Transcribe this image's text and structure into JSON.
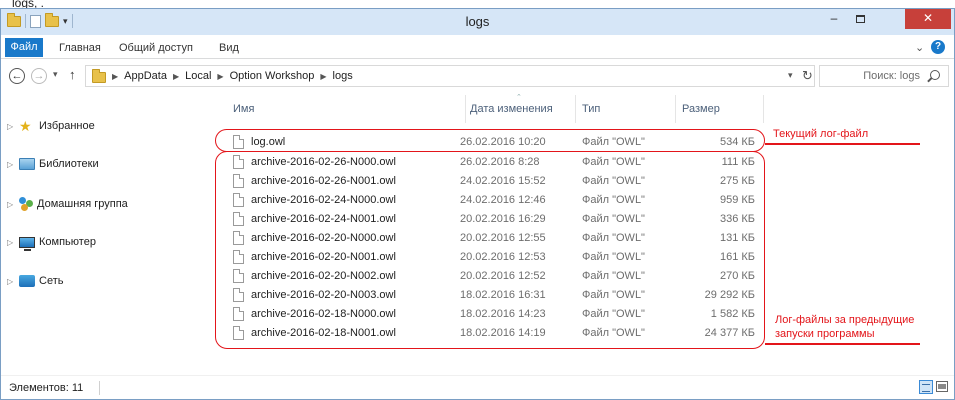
{
  "window": {
    "title": "logs",
    "top_caption": "logs, ."
  },
  "ribbon": {
    "tab_file": "Файл",
    "tab_home": "Главная",
    "tab_share": "Общий доступ",
    "tab_view": "Вид"
  },
  "address": {
    "crumbs": [
      "AppData",
      "Local",
      "Option Workshop",
      "logs"
    ],
    "search_placeholder": "Поиск: logs"
  },
  "nav": {
    "favorites": "Избранное",
    "libraries": "Библиотеки",
    "homegroup": "Домашняя группа",
    "computer": "Компьютер",
    "network": "Сеть"
  },
  "columns": {
    "name": "Имя",
    "date": "Дата изменения",
    "type": "Тип",
    "size": "Размер"
  },
  "files": [
    {
      "name": "log.owl",
      "date": "26.02.2016 10:20",
      "type": "Файл \"OWL\"",
      "size": "534 КБ"
    },
    {
      "name": "archive-2016-02-26-N000.owl",
      "date": "26.02.2016 8:28",
      "type": "Файл \"OWL\"",
      "size": "111 КБ"
    },
    {
      "name": "archive-2016-02-26-N001.owl",
      "date": "24.02.2016 15:52",
      "type": "Файл \"OWL\"",
      "size": "275 КБ"
    },
    {
      "name": "archive-2016-02-24-N000.owl",
      "date": "24.02.2016 12:46",
      "type": "Файл \"OWL\"",
      "size": "959 КБ"
    },
    {
      "name": "archive-2016-02-24-N001.owl",
      "date": "20.02.2016 16:29",
      "type": "Файл \"OWL\"",
      "size": "336 КБ"
    },
    {
      "name": "archive-2016-02-20-N000.owl",
      "date": "20.02.2016 12:55",
      "type": "Файл \"OWL\"",
      "size": "131 КБ"
    },
    {
      "name": "archive-2016-02-20-N001.owl",
      "date": "20.02.2016 12:53",
      "type": "Файл \"OWL\"",
      "size": "161 КБ"
    },
    {
      "name": "archive-2016-02-20-N002.owl",
      "date": "20.02.2016 12:52",
      "type": "Файл \"OWL\"",
      "size": "270 КБ"
    },
    {
      "name": "archive-2016-02-20-N003.owl",
      "date": "18.02.2016 16:31",
      "type": "Файл \"OWL\"",
      "size": "29 292 КБ"
    },
    {
      "name": "archive-2016-02-18-N000.owl",
      "date": "18.02.2016 14:23",
      "type": "Файл \"OWL\"",
      "size": "1 582 КБ"
    },
    {
      "name": "archive-2016-02-18-N001.owl",
      "date": "18.02.2016 14:19",
      "type": "Файл \"OWL\"",
      "size": "24 377 КБ"
    }
  ],
  "annotations": {
    "current_log": "Текущий лог-файл",
    "previous_logs_line1": "Лог-файлы за предыдущие",
    "previous_logs_line2": "запуски программы",
    "color": "#e3151a"
  },
  "status": {
    "items_count": "Элементов: 11"
  },
  "colors": {
    "accent": "#1979ca",
    "close_button": "#c7403a",
    "titlebar": "#d6e6f7"
  }
}
